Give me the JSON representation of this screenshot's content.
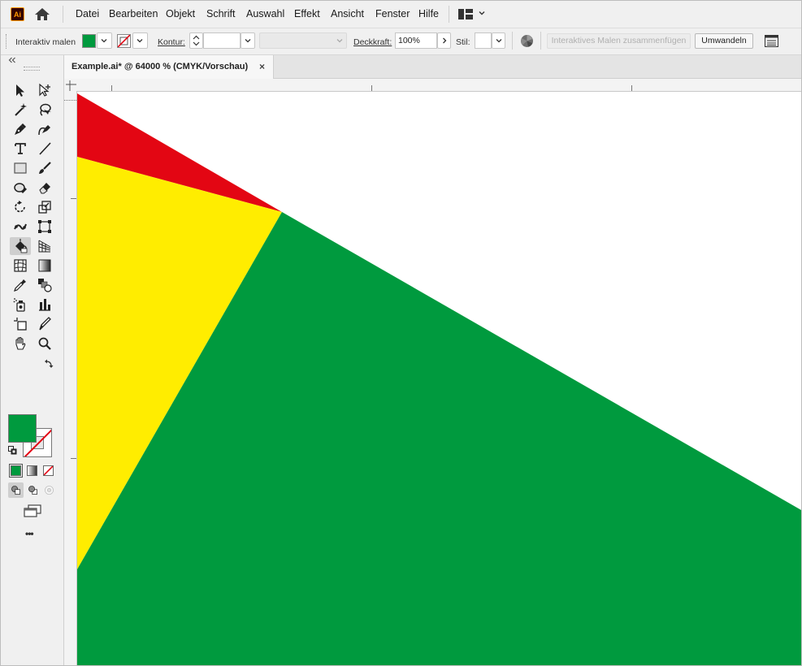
{
  "app": {
    "logo_text": "Ai"
  },
  "menu": {
    "items": [
      "Datei",
      "Bearbeiten",
      "Objekt",
      "Schrift",
      "Auswahl",
      "Effekt",
      "Ansicht",
      "Fenster",
      "Hilfe"
    ]
  },
  "control_bar": {
    "mode_label": "Interaktiv malen",
    "fill_color": "#009a3e",
    "stroke_label": "Kontur:",
    "stroke_weight": "",
    "opacity_label": "Deckkraft:",
    "opacity_value": "100%",
    "style_label": "Stil:",
    "merge_button": "Interaktives Malen zusammenfügen",
    "convert_button": "Umwandeln"
  },
  "document": {
    "tab_title": "Example.ai* @ 64000 % (CMYK/Vorschau)",
    "close_glyph": "×"
  },
  "toolbar": {
    "fill_color": "#009a3e",
    "stroke": "none",
    "more_glyph": "•••"
  },
  "artwork": {
    "colors": {
      "red": "#e30613",
      "yellow": "#ffed00",
      "green": "#009a3e"
    }
  }
}
